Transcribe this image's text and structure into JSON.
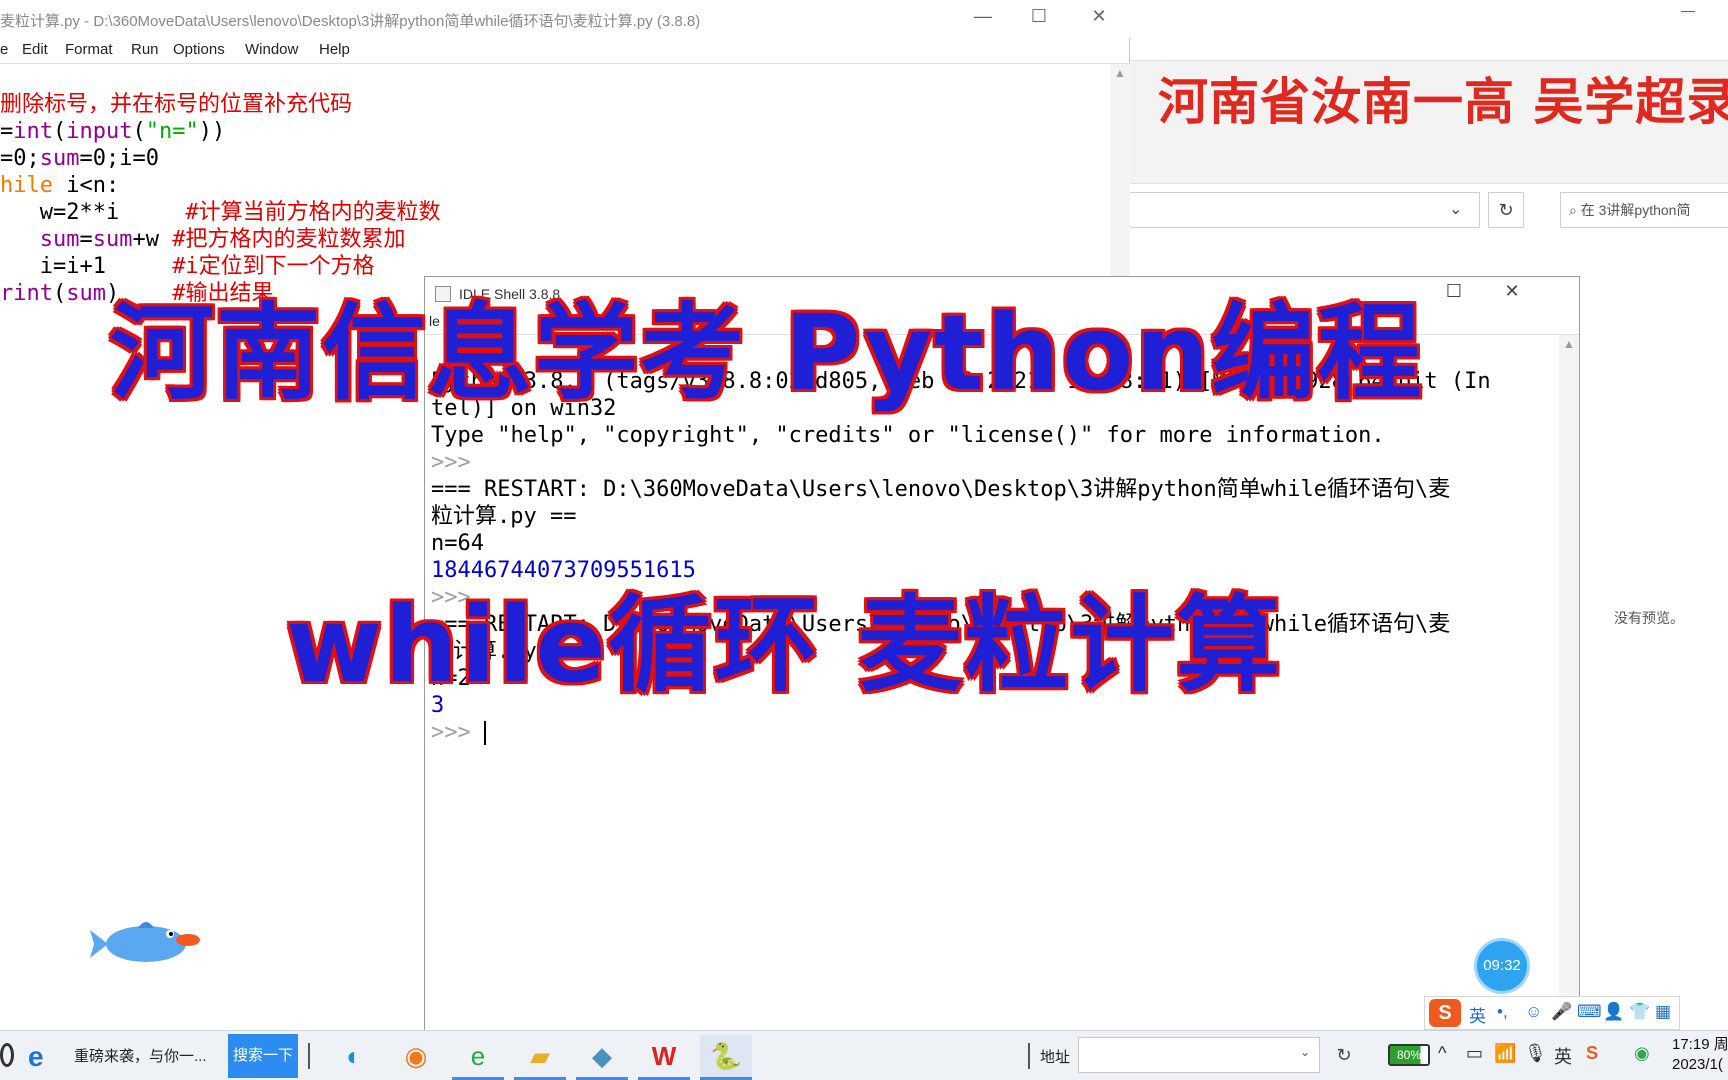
{
  "explorer": {
    "minimize": "—",
    "caption": "河南省汝南一高 吴学超录",
    "refresh": "↻",
    "search_placeholder": "在 3讲解python简",
    "no_preview": "没有预览。"
  },
  "editor": {
    "title": "麦粒计算.py - D:\\360MoveData\\Users\\lenovo\\Desktop\\3讲解python简单while循环语句\\麦粒计算.py (3.8.8)",
    "menu": [
      "e",
      "Edit",
      "Format",
      "Run",
      "Options",
      "Window",
      "Help"
    ],
    "controls": {
      "minimize": "—",
      "maximize": "☐",
      "close": "✕"
    },
    "code": {
      "line1_comment": "删除标号，并在标号的位置补充代码",
      "line2_a": "=",
      "line2_b": "int",
      "line2_c": "(",
      "line2_d": "input",
      "line2_e": "(",
      "line2_f": "\"n=\"",
      "line2_g": "))",
      "line3_a": "=0;",
      "line3_b": "sum",
      "line3_c": "=0;i=0",
      "line4_a": "hile",
      "line4_b": " i<n:",
      "line5_a": "   w=2**i     ",
      "line5_b": "#计算当前方格内的麦粒数",
      "line6_a": "   ",
      "line6_b": "sum",
      "line6_c": "=",
      "line6_d": "sum",
      "line6_e": "+w ",
      "line6_f": "#把方格内的麦粒数累加",
      "line7_a": "   i=i+1     ",
      "line7_b": "#i定位到下一个方格",
      "line8_a": "rint",
      "line8_b": "(",
      "line8_c": "sum",
      "line8_d": ")    ",
      "line8_e": "#输出结果"
    }
  },
  "shell": {
    "title": "IDLE Shell 3.8.8",
    "menu": [
      "le",
      "Ed",
      "Debug",
      "p"
    ],
    "controls": {
      "minimize": "—",
      "maximize": "☐",
      "close": "✕"
    },
    "lines": {
      "l1": "Python 3.8.8 (tags/v3.8.8:024d805, Feb 19 2021, 13:08:11) [MSC v.1928 64 bit (In",
      "l2": "tel)] on win32",
      "l3": "Type \"help\", \"copyright\", \"credits\" or \"license()\" for more information.",
      "l4": ">>>",
      "l5": "=== RESTART: D:\\360MoveData\\Users\\lenovo\\Desktop\\3讲解python简单while循环语句\\麦",
      "l6": "粒计算.py ==",
      "l7": "n=64",
      "l8": "18446744073709551615",
      "l9": ">>>",
      "l10": "=== RESTART: D:\\360MoveData\\Users\\lenovo\\Desktop\\3讲解python简单while循环语句\\麦",
      "l11": "粒计算.py ==",
      "l12": "n=2",
      "l13": "3",
      "l14": ">>> "
    }
  },
  "timer": "09:32",
  "ime": {
    "logo": "S",
    "lang": "英",
    "items": [
      "•,",
      "☺",
      "🎤",
      "⌨",
      "👤",
      "👕",
      "▦"
    ]
  },
  "taskbar": {
    "news": "重磅来袭，与你一...",
    "search_button": "搜索一下",
    "address_label": "地址",
    "refresh": "↻",
    "battery": "80%",
    "tray": [
      "^",
      "▭",
      "📶",
      "🎙",
      "英",
      "S",
      "◉"
    ],
    "time": "17:19 周",
    "date": "2023/1("
  },
  "overlay": {
    "line1": "河南信息学考 Python编程",
    "line2": "while循环 麦粒计算"
  },
  "colors": {
    "overlay_fill": "#1f1fd6",
    "overlay_outline": "#e01010",
    "caption_red": "#e0281e",
    "idle_comment": "#dd0000",
    "idle_keyword": "#ff7700",
    "idle_builtin": "#900090",
    "idle_string": "#00aa00",
    "idle_output": "#0000cc"
  }
}
